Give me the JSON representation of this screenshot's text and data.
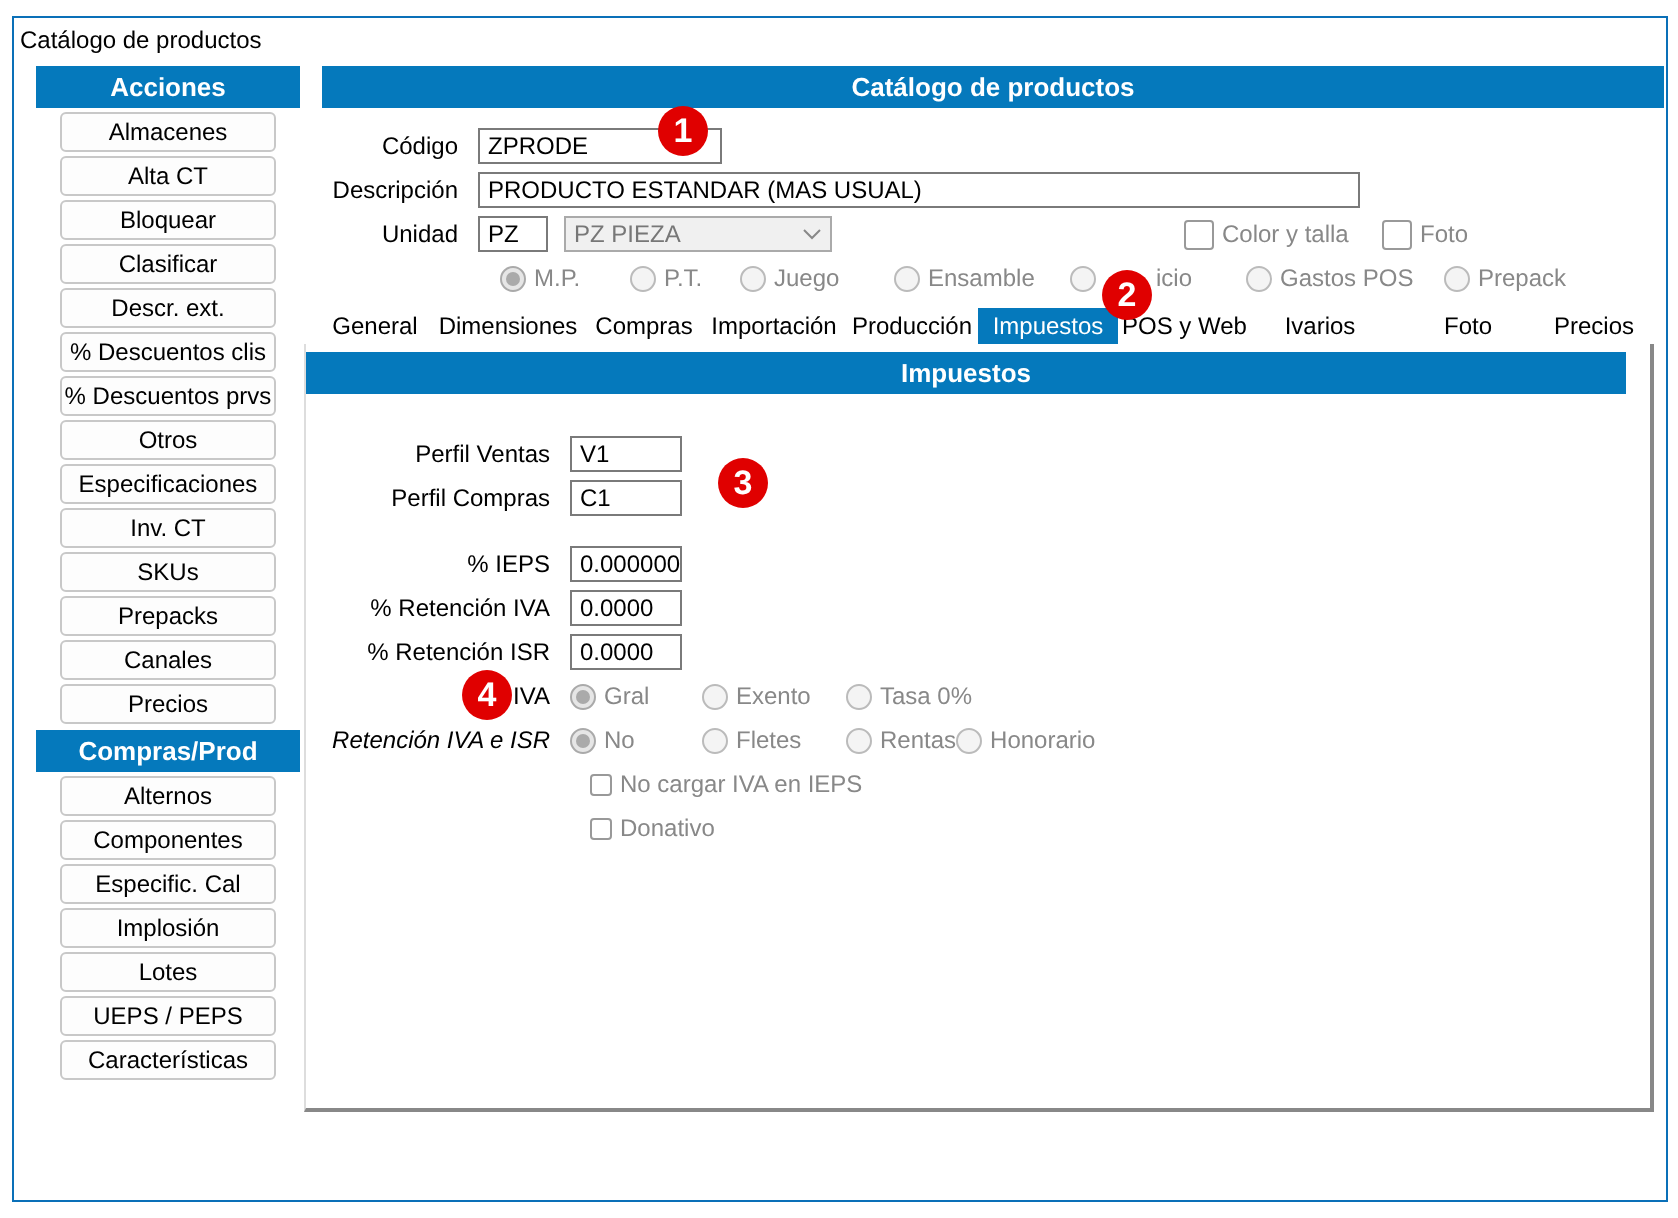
{
  "window": {
    "title": "Catálogo de productos"
  },
  "sidebar": {
    "sections": [
      {
        "title": "Acciones",
        "buttons": [
          "Almacenes",
          "Alta CT",
          "Bloquear",
          "Clasificar",
          "Descr. ext.",
          "%  Descuentos clis",
          "%  Descuentos prvs",
          "Otros",
          "Especificaciones",
          "Inv. CT",
          "SKUs",
          "Prepacks",
          "Canales",
          "Precios"
        ]
      },
      {
        "title": "Compras/Prod",
        "buttons": [
          "Alternos",
          "Componentes",
          "Especific. Cal",
          "Implosión",
          "Lotes",
          "UEPS / PEPS",
          "Características"
        ]
      }
    ]
  },
  "main": {
    "header": "Catálogo de productos",
    "codigo": {
      "label": "Código",
      "value": "ZPRODE"
    },
    "descripcion": {
      "label": "Descripción",
      "value": "PRODUCTO ESTANDAR (MAS USUAL)"
    },
    "unidad": {
      "label": "Unidad",
      "value": "PZ",
      "select_value": "PZ  PIEZA"
    },
    "options": [
      {
        "label": "Color y talla",
        "checked": false
      },
      {
        "label": "Foto",
        "checked": false
      }
    ],
    "product_types": [
      {
        "label": "M.P.",
        "selected": true
      },
      {
        "label": "P.T.",
        "selected": false
      },
      {
        "label": "Juego",
        "selected": false
      },
      {
        "label": "Ensamble",
        "selected": false
      },
      {
        "label": "icio",
        "selected": false
      },
      {
        "label": "Gastos POS",
        "selected": false
      },
      {
        "label": "Prepack",
        "selected": false
      }
    ],
    "tabs": [
      {
        "label": "General",
        "selected": false
      },
      {
        "label": "Dimensiones",
        "selected": false
      },
      {
        "label": "Compras",
        "selected": false
      },
      {
        "label": "Importación",
        "selected": false
      },
      {
        "label": "Producción",
        "selected": false
      },
      {
        "label": "Impuestos",
        "selected": true
      },
      {
        "label": "POS y Web",
        "selected": false
      },
      {
        "label": "Ivarios",
        "selected": false
      },
      {
        "label": "Foto",
        "selected": false
      },
      {
        "label": "Precios",
        "selected": false
      }
    ]
  },
  "tab_panel": {
    "title": "Impuestos",
    "profiles": [
      {
        "label": "Perfil Ventas",
        "value": "V1"
      },
      {
        "label": "Perfil Compras",
        "value": "C1"
      }
    ],
    "rates": [
      {
        "label": "% IEPS",
        "value": "0.000000"
      },
      {
        "label": "% Retención IVA",
        "value": "0.0000"
      },
      {
        "label": "% Retención ISR",
        "value": "0.0000"
      }
    ],
    "radio_groups": [
      {
        "label": "IVA",
        "italic": false,
        "options": [
          {
            "label": "Gral",
            "selected": true
          },
          {
            "label": "Exento",
            "selected": false
          },
          {
            "label": "Tasa 0%",
            "selected": false
          }
        ]
      },
      {
        "label": "Retención IVA e ISR",
        "italic": true,
        "options": [
          {
            "label": "No",
            "selected": true
          },
          {
            "label": "Fletes",
            "selected": false
          },
          {
            "label": "Rentas",
            "selected": false
          },
          {
            "label": "Honorario",
            "selected": false
          }
        ]
      }
    ],
    "checkboxes": [
      {
        "label": "No cargar IVA en IEPS",
        "checked": false
      },
      {
        "label": "Donativo",
        "checked": false
      }
    ]
  },
  "annotations": [
    "1",
    "2",
    "3",
    "4"
  ]
}
